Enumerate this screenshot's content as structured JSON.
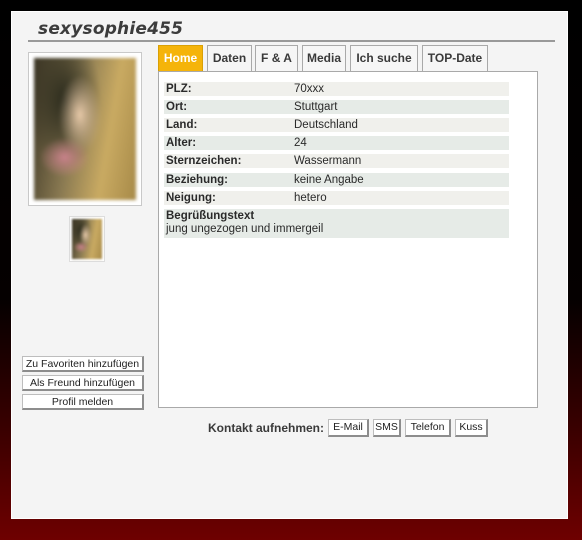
{
  "profile": {
    "username": "sexysophie455"
  },
  "tabs": [
    {
      "label": "Home",
      "active": true
    },
    {
      "label": "Daten",
      "active": false
    },
    {
      "label": "F & A",
      "active": false
    },
    {
      "label": "Media",
      "active": false
    },
    {
      "label": "Ich suche",
      "active": false
    },
    {
      "label": "TOP-Date",
      "active": false
    }
  ],
  "details": [
    {
      "label": "PLZ:",
      "value": "70xxx"
    },
    {
      "label": "Ort:",
      "value": "Stuttgart"
    },
    {
      "label": "Land:",
      "value": "Deutschland"
    },
    {
      "label": "Alter:",
      "value": "24"
    },
    {
      "label": "Sternzeichen:",
      "value": "Wassermann"
    },
    {
      "label": "Beziehung:",
      "value": "keine Angabe"
    },
    {
      "label": "Neigung:",
      "value": "hetero"
    }
  ],
  "greeting": {
    "label": "Begrüßungstext",
    "text": "jung ungezogen und immergeil"
  },
  "actions": {
    "favorite": "Zu Favoriten hinzufügen",
    "friend": "Als Freund hinzufügen",
    "report": "Profil melden"
  },
  "contact": {
    "label": "Kontakt aufnehmen:",
    "buttons": [
      "E-Mail",
      "SMS",
      "Telefon",
      "Kuss"
    ]
  },
  "colors": {
    "active_tab": "#f5b40a",
    "background_bottom": "#6e0000"
  }
}
